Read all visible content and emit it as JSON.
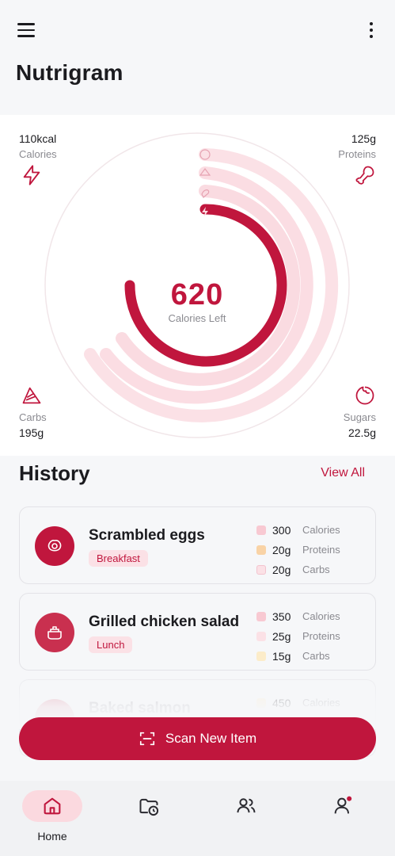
{
  "app": {
    "title": "Nutrigram"
  },
  "summary": {
    "calories_left": "620",
    "calories_left_label": "Calories Left",
    "calories_progress": 0.74,
    "stats": {
      "calories": {
        "value": "110kcal",
        "label": "Calories"
      },
      "proteins": {
        "value": "125g",
        "label": "Proteins"
      },
      "carbs": {
        "value": "195g",
        "label": "Carbs"
      },
      "sugars": {
        "value": "22.5g",
        "label": "Sugars"
      }
    }
  },
  "history": {
    "title": "History",
    "view_all": "View All",
    "items": [
      {
        "name": "Scrambled eggs",
        "meal": "Breakfast",
        "calories": "300",
        "proteins": "20g",
        "carbs": "20g",
        "calories_unit": "Calories",
        "proteins_unit": "Proteins",
        "carbs_unit": "Carbs"
      },
      {
        "name": "Grilled chicken salad",
        "meal": "Lunch",
        "calories": "350",
        "proteins": "25g",
        "carbs": "15g",
        "calories_unit": "Calories",
        "proteins_unit": "Proteins",
        "carbs_unit": "Carbs"
      },
      {
        "name": "Baked salmon",
        "calories": "450",
        "calories_unit": "Calories"
      }
    ]
  },
  "scan_button": "Scan New Item",
  "nav": {
    "home": "Home"
  },
  "colors": {
    "accent": "#c0163d",
    "accent_light": "#fbd9df",
    "ring_bg": "#fbe1e6"
  },
  "icons": {
    "menu": "menu-icon",
    "more": "more-vert-icon",
    "calories": "lightning-icon",
    "proteins": "drumstick-icon",
    "carbs": "bread-icon",
    "sugars": "candy-icon",
    "egg": "egg-icon",
    "salad": "bowl-icon",
    "scan": "scan-icon",
    "home": "home-icon",
    "history": "folder-clock-icon",
    "community": "people-icon",
    "profile": "profile-icon"
  }
}
